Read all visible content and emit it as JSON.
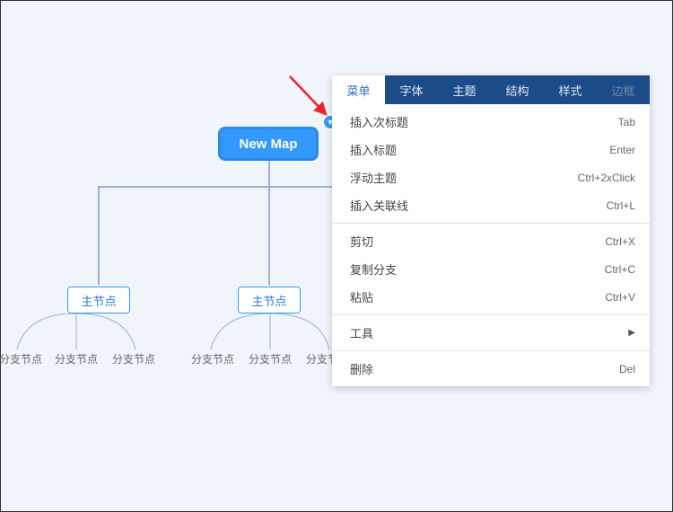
{
  "root": {
    "label": "New Map"
  },
  "main_nodes": [
    {
      "label": "主节点"
    },
    {
      "label": "主节点"
    }
  ],
  "sub_label": "分支节点",
  "tabs": [
    {
      "label": "菜单",
      "state": "active"
    },
    {
      "label": "字体",
      "state": "normal"
    },
    {
      "label": "主题",
      "state": "normal"
    },
    {
      "label": "结构",
      "state": "normal"
    },
    {
      "label": "样式",
      "state": "normal"
    },
    {
      "label": "边框",
      "state": "disabled"
    }
  ],
  "menu": {
    "group1": [
      {
        "label": "插入次标题",
        "shortcut": "Tab"
      },
      {
        "label": "插入标题",
        "shortcut": "Enter"
      },
      {
        "label": "浮动主题",
        "shortcut": "Ctrl+2xClick"
      },
      {
        "label": "插入关联线",
        "shortcut": "Ctrl+L"
      }
    ],
    "group2": [
      {
        "label": "剪切",
        "shortcut": "Ctrl+X"
      },
      {
        "label": "复制分支",
        "shortcut": "Ctrl+C"
      },
      {
        "label": "粘贴",
        "shortcut": "Ctrl+V"
      }
    ],
    "group3": [
      {
        "label": "工具",
        "submenu": true
      }
    ],
    "group4": [
      {
        "label": "删除",
        "shortcut": "Del"
      }
    ]
  }
}
